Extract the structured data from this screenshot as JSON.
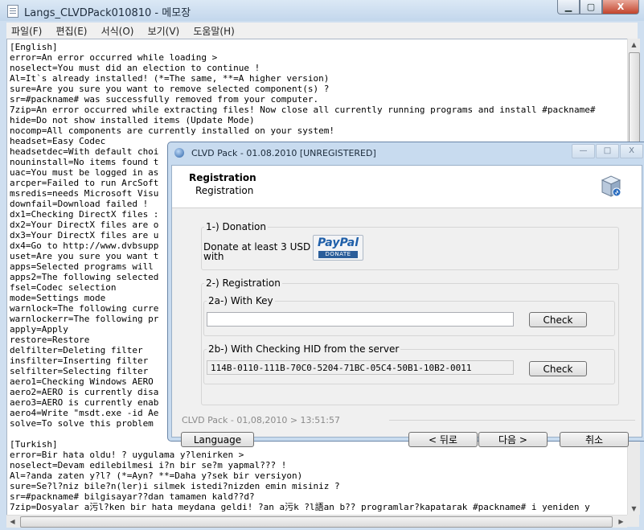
{
  "notepad": {
    "title": "Langs_CLVDPack010810 - 메모장",
    "caption": {
      "minimize": "▁",
      "maximize": "▢",
      "close": "X"
    },
    "menu": [
      "파일(F)",
      "편집(E)",
      "서식(O)",
      "보기(V)",
      "도움말(H)"
    ],
    "lines": [
      "[English]",
      "error=An error occurred while loading >",
      "noselect=You must did an election to continue !",
      "Al=It`s already installed! (*=The same, **=A higher version)",
      "sure=Are you sure you want to remove selected component(s) ?",
      "sr=#packname# was successfully removed from your computer.",
      "7zip=An error occurred while extracting files! Now close all currently running programs and install #packname#",
      "hide=Do not show installed items (Update Mode)",
      "nocomp=All components are currently installed on your system!",
      "headset=Easy Codec",
      "headsetdec=With default choi",
      "nouninstall=No items found t",
      "uac=You must be logged in as",
      "arcper=Failed to run ArcSoft",
      "msredis=needs Microsoft Visu",
      "downfail=Download failed ! ",
      "dx1=Checking DirectX files :",
      "dx2=Your DirectX files are o",
      "dx3=Your DirectX files are u",
      "dx4=Go to http://www.dvbsupp",
      "uset=Are you sure you want t",
      "apps=Selected programs will ",
      "apps2=The following selected",
      "fsel=Codec selection",
      "mode=Settings mode",
      "warnlock=The following curre",
      "warnlockerr=The following pr",
      "apply=Apply",
      "restore=Restore",
      "delfilter=Deleting filter",
      "insfilter=Inserting filter",
      "selfilter=Selecting filter",
      "aero1=Checking Windows AERO",
      "aero2=AERO is currently disa",
      "aero3=AERO is currently enab",
      "aero4=Write \"msdt.exe -id Ae",
      "solve=To solve this problem ",
      "",
      "[Turkish]",
      "error=Bir hata oldu! ? uygulama y?lenirken >",
      "noselect=Devam edilebilmesi i?n bir se?m yapmal??? !",
      "Al=?anda zaten y?l? (*=Ayn? **=Daha y?sek bir versiyon)",
      "sure=Se?l?niz bile?n(ler)i silmek istedi?nizden emin misiniz ?",
      "sr=#packname# bilgisayar??dan tamamen kald??d?",
      "7zip=Dosyalar a污l?ken bir hata meydana geldi! ?an a污k ?l語an b?? programlar?kapatarak #packname# i yeniden y"
    ]
  },
  "dialog": {
    "title": "CLVD Pack - 01.08.2010 [UNREGISTERED]",
    "caption": {
      "minimize": "—",
      "maximize": "□",
      "close": "X"
    },
    "header_title": "Registration",
    "header_subtitle": "Registration",
    "donation": {
      "group_label": "1-) Donation",
      "text_line1": "Donate at least 3 USD",
      "text_line2": "with",
      "paypal_logo": "PayPal",
      "paypal_sub": "DONATE"
    },
    "registration": {
      "group_label": "2-) Registration",
      "with_key_label": "2a-) With Key",
      "key_value": "",
      "check_button": "Check",
      "hid_label": "2b-) With Checking HID from the server",
      "hid_value": "114B-0110-111B-70C0-5204-71BC-05C4-50B1-10B2-0011",
      "check_button2": "Check"
    },
    "footer_text": "CLVD Pack - 01,08,2010 > 13:51:57",
    "buttons": {
      "language": "Language",
      "back": "< 뒤로",
      "next": "다음 >",
      "cancel": "취소"
    }
  }
}
